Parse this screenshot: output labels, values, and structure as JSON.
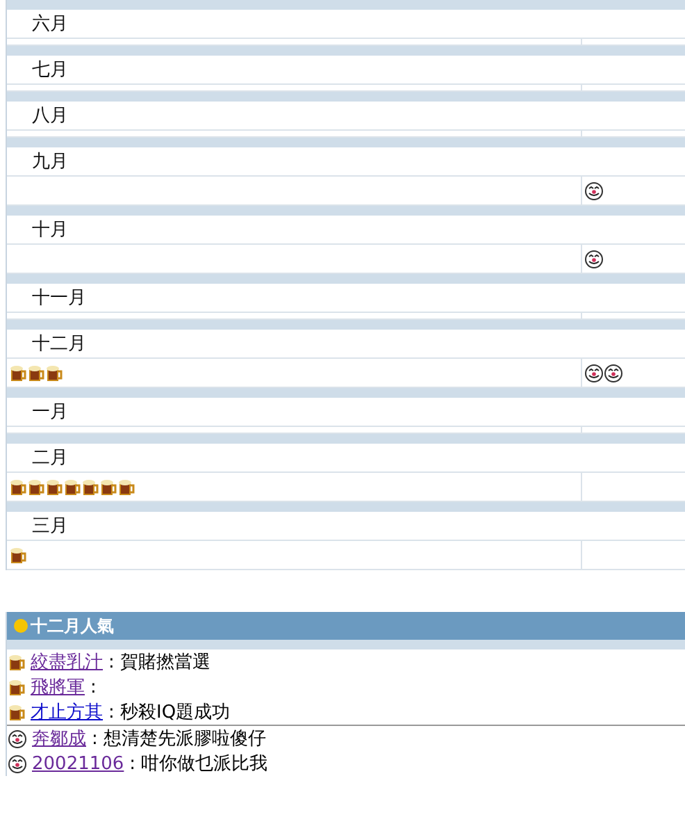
{
  "months": [
    {
      "label": "六月"
    },
    {
      "label": "七月"
    },
    {
      "label": "八月"
    },
    {
      "label": "九月",
      "right_icons": [
        {
          "kind": "clown"
        }
      ]
    },
    {
      "label": "十月",
      "right_icons": [
        {
          "kind": "clown"
        }
      ]
    },
    {
      "label": "十一月"
    },
    {
      "label": "十二月",
      "left_icons": [
        {
          "kind": "beer"
        },
        {
          "kind": "beer"
        },
        {
          "kind": "beer"
        }
      ],
      "right_icons": [
        {
          "kind": "clown"
        },
        {
          "kind": "clown"
        }
      ]
    },
    {
      "label": "一月"
    },
    {
      "label": "二月",
      "left_icons": [
        {
          "kind": "beer"
        },
        {
          "kind": "beer"
        },
        {
          "kind": "beer"
        },
        {
          "kind": "beer"
        },
        {
          "kind": "beer"
        },
        {
          "kind": "beer"
        },
        {
          "kind": "beer"
        }
      ]
    },
    {
      "label": "三月",
      "left_icons": [
        {
          "kind": "beer"
        }
      ]
    }
  ],
  "popular": {
    "title": "十二月人氣",
    "entries": [
      {
        "kind": "beer",
        "name": "絞盡乳汁",
        "visited": true,
        "message": ": 賀賭撚當選"
      },
      {
        "kind": "beer",
        "name": "飛將軍",
        "visited": true,
        "message": ":"
      },
      {
        "kind": "beer",
        "name": "才止方其",
        "visited": false,
        "message": ": 秒殺IQ題成功"
      },
      {
        "kind": "clown",
        "name": "奔鄒成",
        "visited": true,
        "message": ": 想清楚先派膠啦傻仔"
      },
      {
        "kind": "clown",
        "name": "20021106",
        "visited": true,
        "message": ": 咁你做乜派比我"
      }
    ]
  }
}
